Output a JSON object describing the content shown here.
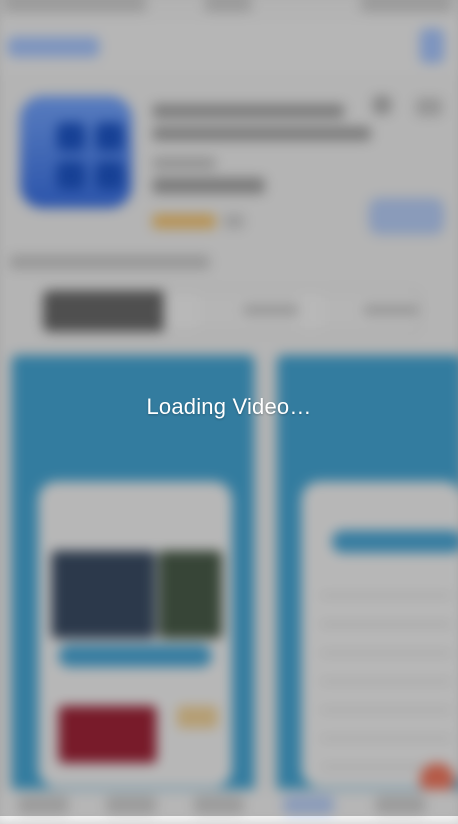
{
  "overlay": {
    "loading_text": "Loading Video…"
  },
  "colors": {
    "overlay_tint": "#000000",
    "brand_blue": "#45a6d5",
    "accent_orange": "#f2785f"
  }
}
